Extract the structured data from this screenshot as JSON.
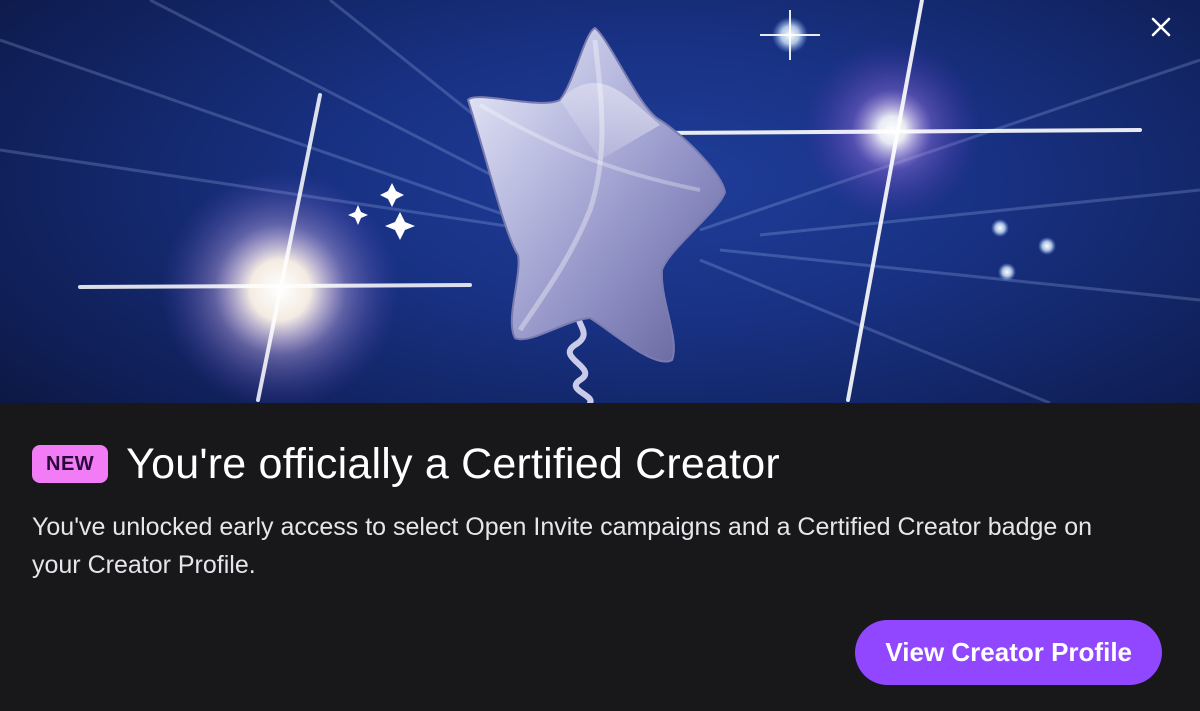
{
  "hero": {
    "illustration": "silver-star-balloon-with-sparkles",
    "close_icon": "close-icon"
  },
  "announcement": {
    "badge": "NEW",
    "title": "You're officially a Certified Creator",
    "description": "You've unlocked early access to select Open Invite campaigns and a Certified Creator badge on your Creator Profile."
  },
  "actions": {
    "primary_label": "View Creator Profile"
  },
  "colors": {
    "background": "#18181b",
    "hero_blue": "#183182",
    "badge": "#f27cf5",
    "button": "#9147ff"
  }
}
